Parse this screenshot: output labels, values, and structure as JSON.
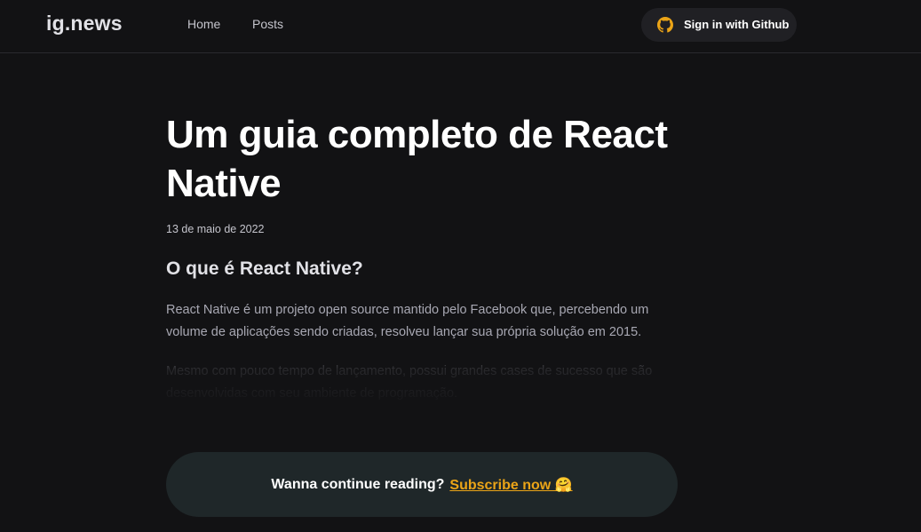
{
  "header": {
    "logo": "ig.news",
    "nav": [
      {
        "label": "Home"
      },
      {
        "label": "Posts"
      }
    ],
    "signin": {
      "label": "Sign in with Github",
      "icon": "github-icon",
      "icon_color": "#eba417"
    }
  },
  "article": {
    "title": "Um guia completo de React Native",
    "date": "13 de maio de 2022",
    "section_heading": "O que é React Native?",
    "paragraphs": [
      "React Native é um projeto open source mantido pelo Facebook que, percebendo um volume de aplicações sendo criadas, resolveu lançar sua própria solução em 2015.",
      "Mesmo com pouco tempo de lançamento, possui grandes cases de sucesso que são desenvolvidas com seu ambiente de programação."
    ]
  },
  "cta": {
    "text": "Wanna continue reading?",
    "link": "Subscribe now 🤗"
  },
  "colors": {
    "background": "#121214",
    "accent": "#eba417",
    "cta_background": "#1f2729"
  }
}
